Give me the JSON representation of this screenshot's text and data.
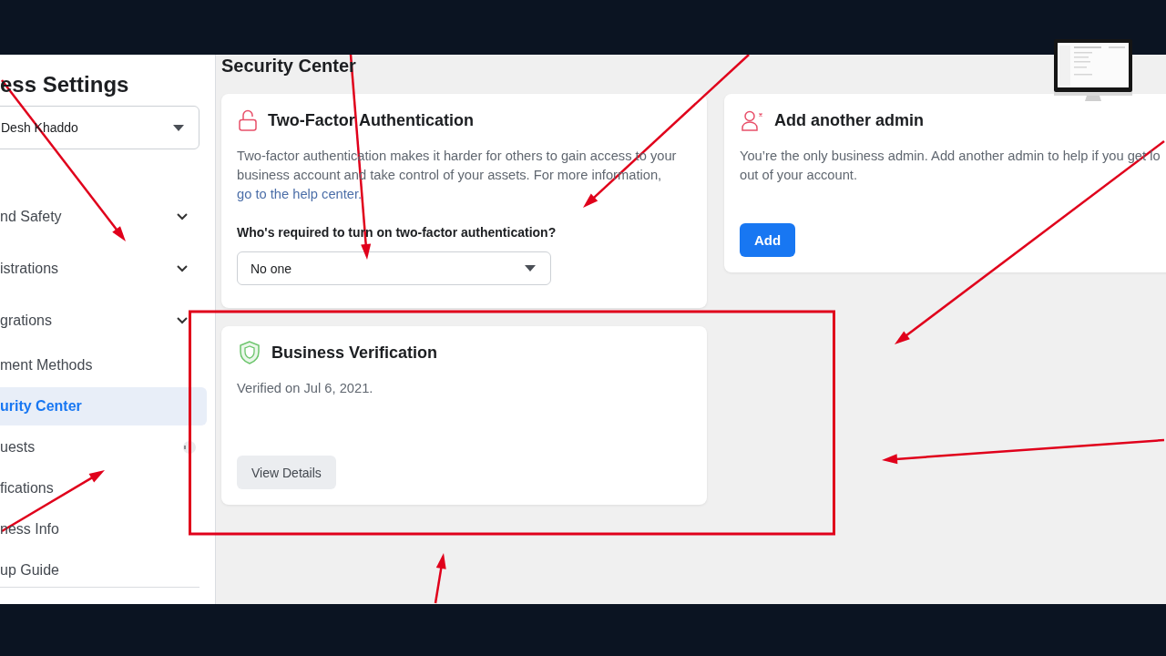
{
  "sidebar": {
    "title": "ess Settings",
    "account_selector": {
      "value": "Desh Khaddo"
    },
    "items": [
      {
        "label": "nd Safety",
        "kind": "group",
        "expanded": false,
        "selected": false,
        "badge": false
      },
      {
        "label": "istrations",
        "kind": "group",
        "expanded": false,
        "selected": false,
        "badge": false
      },
      {
        "label": "grations",
        "kind": "group",
        "expanded": false,
        "selected": false,
        "badge": false
      },
      {
        "label": "ment Methods",
        "kind": "link",
        "selected": false,
        "badge": false
      },
      {
        "label": "urity Center",
        "kind": "link",
        "selected": true,
        "badge": false
      },
      {
        "label": "uests",
        "kind": "link",
        "selected": false,
        "badge": true
      },
      {
        "label": "fications",
        "kind": "link",
        "selected": false,
        "badge": false
      },
      {
        "label": "ness Info",
        "kind": "link",
        "selected": false,
        "badge": false
      },
      {
        "label": "up Guide",
        "kind": "link",
        "selected": false,
        "badge": false
      }
    ]
  },
  "page": {
    "title": "Security Center"
  },
  "cards": [
    {
      "kind": "two_factor",
      "title": "Two-Factor Authentication",
      "description": "Two-factor authentication makes it harder for others to gain access to your business account and take control of your assets. For more information,",
      "link": "go to the help center.",
      "question": "Who's required to turn on two-factor authentication?",
      "select": {
        "value": "No one"
      }
    },
    {
      "kind": "admin",
      "title": "Add another admin",
      "description_lines": [
        "You’re the only business admin. Add another admin to help if you get lo",
        "out of your account."
      ],
      "button": {
        "label": "Add",
        "kind": "primary"
      }
    },
    {
      "kind": "verification",
      "title": "Business Verification",
      "description": "Verified on Jul 6, 2021.",
      "button": {
        "label": "View Details",
        "kind": "secondary"
      }
    }
  ]
}
